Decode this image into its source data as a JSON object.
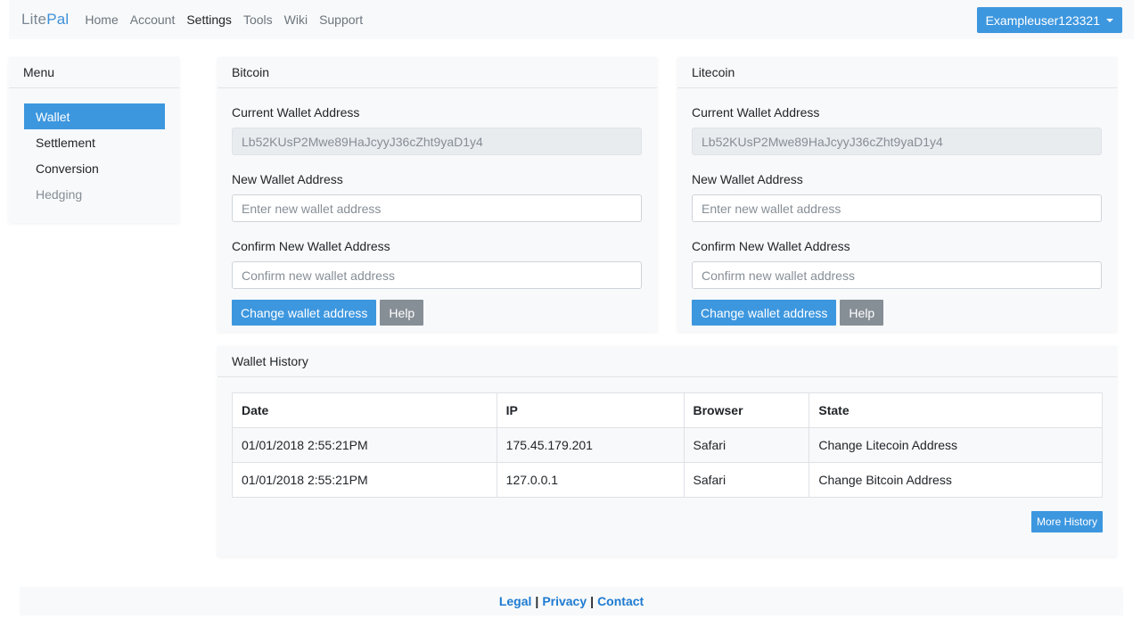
{
  "brand": {
    "part1": "Lite",
    "part2": "Pal"
  },
  "nav": {
    "items": [
      "Home",
      "Account",
      "Settings",
      "Tools",
      "Wiki",
      "Support"
    ],
    "active": "Settings"
  },
  "user": {
    "name": "Exampleuser123321"
  },
  "menu": {
    "title": "Menu",
    "items": [
      "Wallet",
      "Settlement",
      "Conversion",
      "Hedging"
    ]
  },
  "bitcoin": {
    "title": "Bitcoin",
    "current_label": "Current Wallet Address",
    "current_value": "Lb52KUsP2Mwe89HaJcyyJ36cZht9yaD1y4",
    "new_label": "New Wallet Address",
    "new_placeholder": "Enter new wallet address",
    "confirm_label": "Confirm New Wallet Address",
    "confirm_placeholder": "Confirm new wallet address",
    "change_button": "Change wallet address",
    "help_button": "Help"
  },
  "litecoin": {
    "title": "Litecoin",
    "current_label": "Current Wallet Address",
    "current_value": "Lb52KUsP2Mwe89HaJcyyJ36cZht9yaD1y4",
    "new_label": "New Wallet Address",
    "new_placeholder": "Enter new wallet address",
    "confirm_label": "Confirm New Wallet Address",
    "confirm_placeholder": "Confirm new wallet address",
    "change_button": "Change wallet address",
    "help_button": "Help"
  },
  "history": {
    "title": "Wallet History",
    "columns": [
      "Date",
      "IP",
      "Browser",
      "State"
    ],
    "rows": [
      [
        "01/01/2018 2:55:21PM",
        "175.45.179.201",
        "Safari",
        "Change Litecoin Address"
      ],
      [
        "01/01/2018 2:55:21PM",
        "127.0.0.1",
        "Safari",
        "Change Bitcoin Address"
      ]
    ],
    "more_button": "More History"
  },
  "footer": {
    "legal": "Legal",
    "privacy": "Privacy",
    "contact": "Contact",
    "separator": "|"
  }
}
